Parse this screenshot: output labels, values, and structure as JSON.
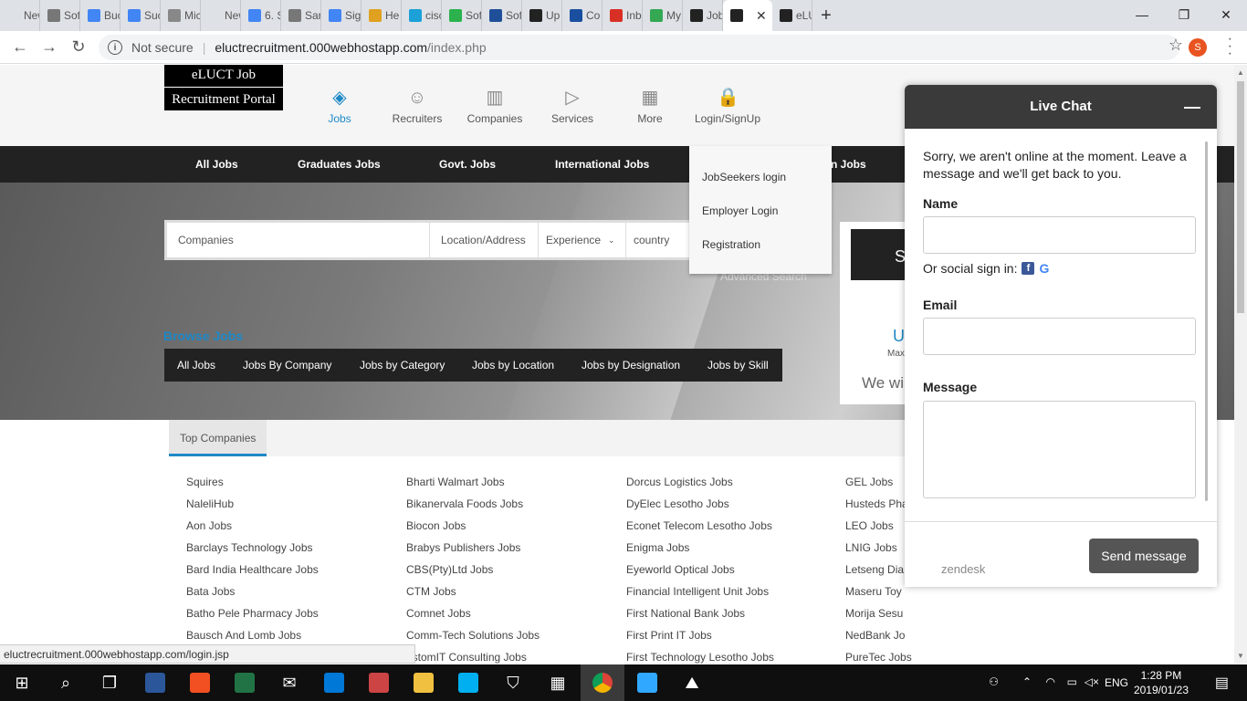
{
  "browser": {
    "tabs": [
      {
        "title": "New Ta",
        "favicon_color": "#dee1e6"
      },
      {
        "title": "Sof",
        "favicon_color": "#777777"
      },
      {
        "title": "Buc",
        "favicon_color": "#4285f4"
      },
      {
        "title": "Suc",
        "favicon_color": "#4285f4"
      },
      {
        "title": "Mic",
        "favicon_color": "#888888"
      },
      {
        "title": "New Ta",
        "favicon_color": "#dee1e6"
      },
      {
        "title": "6. S",
        "favicon_color": "#4285f4"
      },
      {
        "title": "Sar",
        "favicon_color": "#777777"
      },
      {
        "title": "Sig",
        "favicon_color": "#4285f4"
      },
      {
        "title": "He",
        "favicon_color": "#e0a020"
      },
      {
        "title": "cisc",
        "favicon_color": "#1ba0d7"
      },
      {
        "title": "Sof",
        "favicon_color": "#2bb24c"
      },
      {
        "title": "Sof",
        "favicon_color": "#1f4f99"
      },
      {
        "title": "Up",
        "favicon_color": "#222222"
      },
      {
        "title": "Co",
        "favicon_color": "#1a4fa0"
      },
      {
        "title": "Inb",
        "favicon_color": "#d93025"
      },
      {
        "title": "My",
        "favicon_color": "#34a853"
      },
      {
        "title": "Job",
        "favicon_color": "#222222"
      },
      {
        "title": "",
        "favicon_color": "#222222",
        "active": true
      },
      {
        "title": "eLU",
        "favicon_color": "#222222"
      }
    ],
    "new_tab": "+",
    "window_controls": {
      "minimize": "—",
      "maximize": "❐",
      "close": "✕"
    },
    "back": "←",
    "forward": "→",
    "reload": "↻",
    "not_secure": "Not secure",
    "url_host": "eluctrecruitment.000webhostapp.com",
    "url_path": "/index.php",
    "profile_initial": "S",
    "status_url": "eluctrecruitment.000webhostapp.com/login.jsp"
  },
  "site": {
    "logo_line1": "eLUCT Job",
    "logo_line2": "Recruitment Portal",
    "header_nav": [
      {
        "label": "Jobs",
        "icon": "layers-icon",
        "active": true
      },
      {
        "label": "Recruiters",
        "icon": "user-icon"
      },
      {
        "label": "Companies",
        "icon": "building-icon"
      },
      {
        "label": "Services",
        "icon": "play-icon"
      },
      {
        "label": "More",
        "icon": "grid-icon"
      },
      {
        "label": "Login/SignUp",
        "icon": "lock-icon"
      }
    ],
    "category_bar": [
      "All Jobs",
      "Graduates Jobs",
      "Govt. Jobs",
      "International Jobs",
      "n Jobs"
    ],
    "search": {
      "companies_placeholder": "Companies",
      "location_placeholder": "Location/Address",
      "experience": "Experience",
      "country": "country",
      "advanced": "Advanced Search"
    },
    "right_panel": {
      "button": "S",
      "headline": "U",
      "max": "Max",
      "we": "We wi"
    },
    "login_dropdown": [
      "JobSeekers login",
      "Employer Login",
      "Registration"
    ],
    "browse_title": "Browse Jobs",
    "browse_tabs": [
      "All Jobs",
      "Jobs By Company",
      "Jobs by Category",
      "Jobs by Location",
      "Jobs by Designation",
      "Jobs by Skill"
    ],
    "top_companies_tab": "Top Companies",
    "companies": [
      [
        "Squires",
        "NaleliHub",
        "Aon Jobs",
        "Barclays Technology Jobs",
        "Bard India Healthcare Jobs",
        "Bata Jobs",
        "Batho Pele Pharmacy Jobs",
        "Bausch And Lomb Jobs"
      ],
      [
        "Bharti Walmart Jobs",
        "Bikanervala Foods Jobs",
        "Biocon Jobs",
        "Brabys Publishers Jobs",
        "CBS(Pty)Ltd Jobs",
        "CTM Jobs",
        "Comnet Jobs",
        "Comm-Tech Solutions Jobs",
        "ustomIT Consulting Jobs"
      ],
      [
        "Dorcus Logistics Jobs",
        "DyElec Lesotho Jobs",
        "Econet Telecom Lesotho Jobs",
        "Enigma Jobs",
        "Eyeworld Optical Jobs",
        "Financial Intelligent Unit Jobs",
        "First National Bank Jobs",
        "First Print IT Jobs",
        "First Technology Lesotho Jobs"
      ],
      [
        "GEL Jobs",
        "Husteds Pha",
        "LEO Jobs",
        "LNIG Jobs",
        "Letseng Dia",
        "Maseru Toy",
        "Morija Sesu",
        "NedBank Jo",
        "PureTec Jobs"
      ]
    ]
  },
  "chat": {
    "title": "Live Chat",
    "minimize": "—",
    "message": "Sorry, we aren't online at the moment. Leave a message and we'll get back to you.",
    "name_label": "Name",
    "social_label": "Or social sign in:",
    "email_label": "Email",
    "message_label": "Message",
    "brand": "zendesk",
    "send": "Send message"
  },
  "taskbar": {
    "apps": [
      {
        "name": "start",
        "color": "#ffffff"
      },
      {
        "name": "search",
        "color": "#ffffff"
      },
      {
        "name": "task-view",
        "color": "#ffffff"
      },
      {
        "name": "word",
        "color": "#2b579a"
      },
      {
        "name": "store",
        "color": "#f25022"
      },
      {
        "name": "excel",
        "color": "#217346"
      },
      {
        "name": "mail",
        "color": "#ffffff"
      },
      {
        "name": "edge",
        "color": "#0078d7"
      },
      {
        "name": "paint",
        "color": "#cc4444"
      },
      {
        "name": "explorer",
        "color": "#f0c040"
      },
      {
        "name": "skype",
        "color": "#00aff0"
      },
      {
        "name": "defender",
        "color": "#ffffff"
      },
      {
        "name": "calculator",
        "color": "#ffffff"
      },
      {
        "name": "chrome",
        "color": "#db4437"
      },
      {
        "name": "photoshop",
        "color": "#31a8ff"
      },
      {
        "name": "photos",
        "color": "#ffffff"
      }
    ],
    "lang": "ENG",
    "time": "1:28 PM",
    "date": "2019/01/23"
  }
}
